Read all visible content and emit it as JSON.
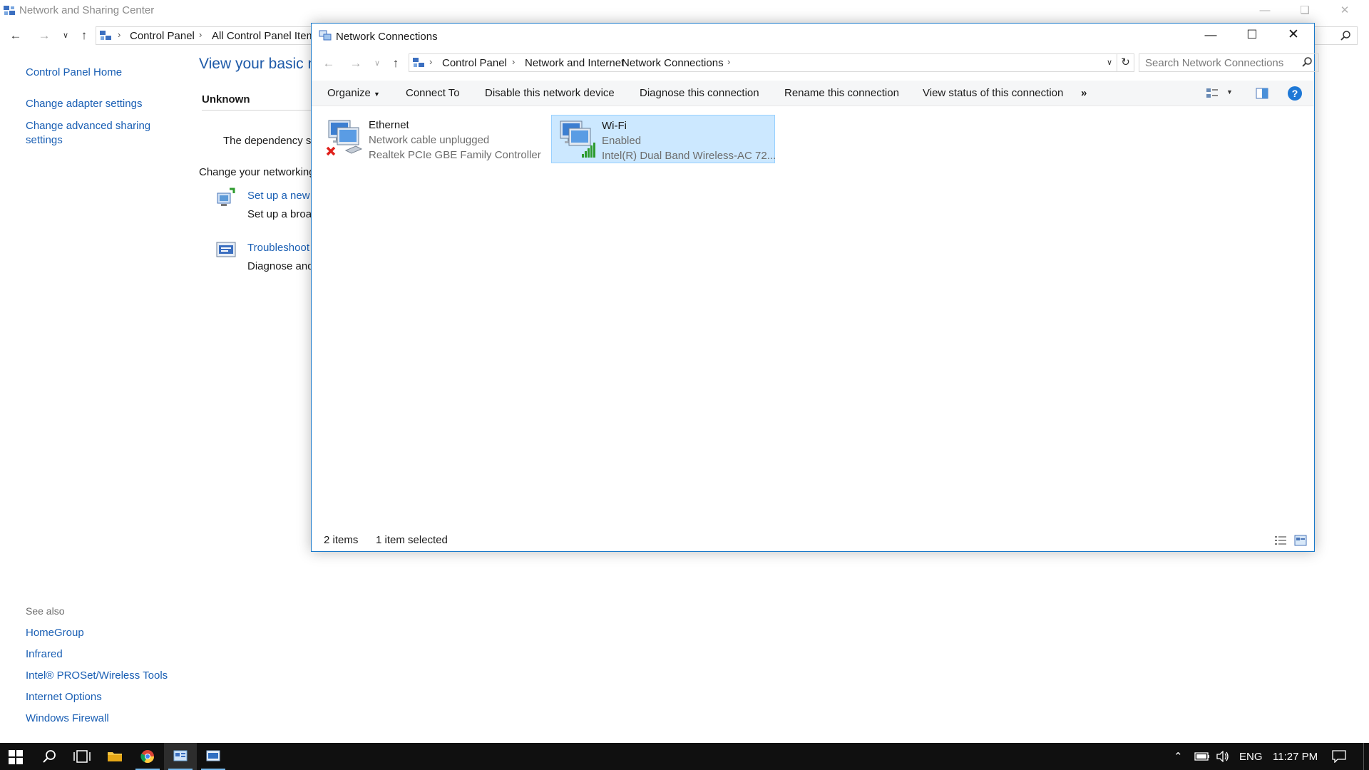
{
  "background_window": {
    "title": "Network and Sharing Center",
    "breadcrumb": [
      "Control Panel",
      "All Control Panel Item"
    ],
    "sidebar_links": [
      "Control Panel Home",
      "Change adapter settings",
      "Change advanced sharing",
      "settings"
    ],
    "heading": "View your basic ne",
    "network_name": "Unknown",
    "dependency_text": "The dependency se",
    "change_networking": "Change your networking",
    "setup_link": "Set up a new",
    "setup_desc": "Set up a broa",
    "troubleshoot_link": "Troubleshoot",
    "troubleshoot_desc": "Diagnose and",
    "see_also_label": "See also",
    "see_also_links": [
      "HomeGroup",
      "Infrared",
      "Intel® PROSet/Wireless Tools",
      "Internet Options",
      "Windows Firewall"
    ]
  },
  "window": {
    "title": "Network Connections",
    "breadcrumb": [
      "Control Panel",
      "Network and Internet",
      "Network Connections"
    ],
    "search_placeholder": "Search Network Connections",
    "commands": [
      "Organize",
      "Connect To",
      "Disable this network device",
      "Diagnose this connection",
      "Rename this connection",
      "View status of this connection",
      "»"
    ],
    "items": [
      {
        "name": "Ethernet",
        "status": "Network cable unplugged",
        "device": "Realtek PCIe GBE Family Controller",
        "selected": false
      },
      {
        "name": "Wi-Fi",
        "status": "Enabled",
        "device": "Intel(R) Dual Band Wireless-AC 72...",
        "selected": true
      }
    ],
    "status": {
      "count": "2 items",
      "selection": "1 item selected"
    }
  },
  "taskbar": {
    "language": "ENG",
    "time": "11:27 PM"
  },
  "colors": {
    "link": "#1a5fb4",
    "selection_bg": "#cce8ff",
    "selection_border": "#99d1ff",
    "window_border": "#1979ca",
    "taskbar": "#101010"
  }
}
